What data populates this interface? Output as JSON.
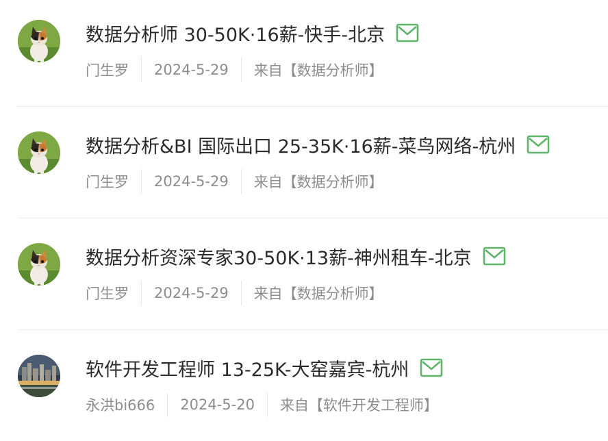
{
  "posts": [
    {
      "title": "数据分析师 30-50K·16薪-快手-北京",
      "author": "门生罗",
      "date": "2024-5-29",
      "source": "来自【数据分析师】",
      "avatar": "cat-avatar"
    },
    {
      "title": "数据分析&BI 国际出口 25-35K·16薪-菜鸟网络-杭州",
      "author": "门生罗",
      "date": "2024-5-29",
      "source": "来自【数据分析师】",
      "avatar": "cat-avatar"
    },
    {
      "title": "数据分析资深专家30-50K·13薪-神州租车-北京",
      "author": "门生罗",
      "date": "2024-5-29",
      "source": "来自【数据分析师】",
      "avatar": "cat-avatar"
    },
    {
      "title": "软件开发工程师 13-25K-大窑嘉宾-杭州",
      "author": "永洪bi666",
      "date": "2024-5-20",
      "source": "来自【软件开发工程师】",
      "avatar": "city-avatar"
    }
  ],
  "colors": {
    "title": "#2b2b2b",
    "meta": "#8d8d8d",
    "mail_icon": "#5fb36a",
    "divider": "#ececec"
  },
  "icons": {
    "mail": "mail-icon"
  }
}
